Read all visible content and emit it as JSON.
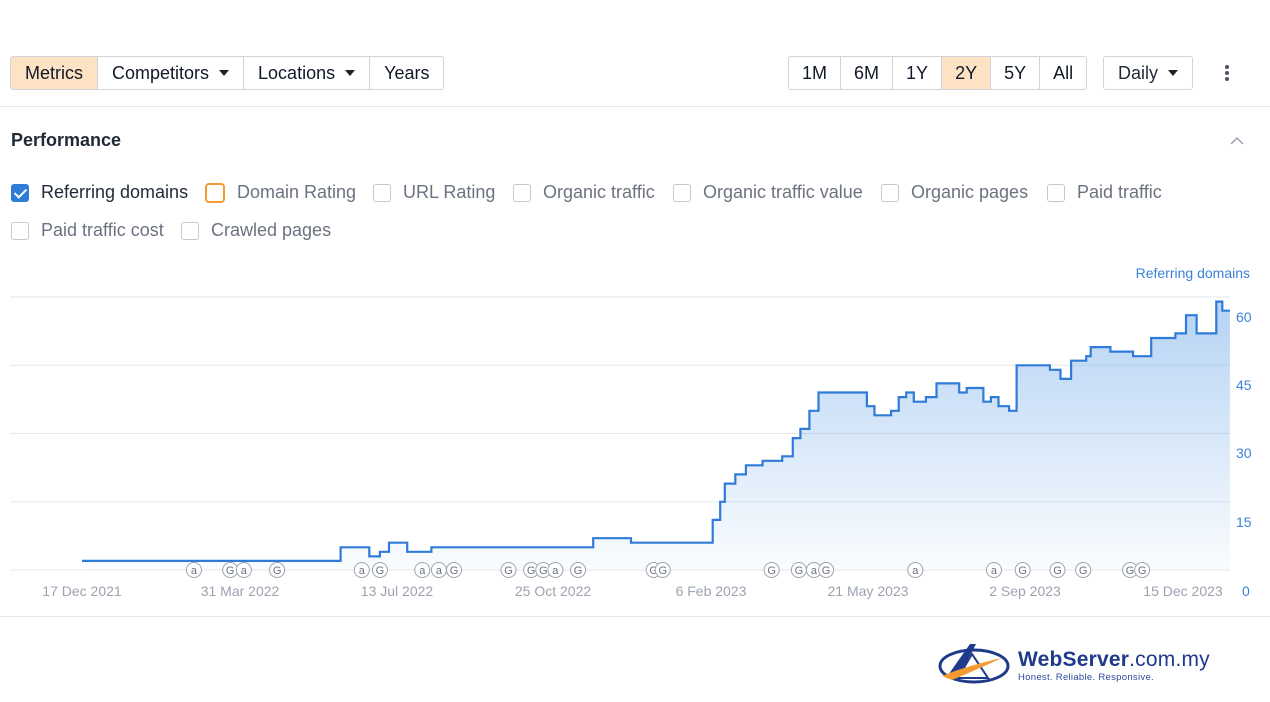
{
  "toolbar": {
    "tabs": [
      {
        "label": "Metrics",
        "active": true
      },
      {
        "label": "Competitors",
        "dropdown": true
      },
      {
        "label": "Locations",
        "dropdown": true
      },
      {
        "label": "Years"
      }
    ],
    "ranges": [
      {
        "label": "1M"
      },
      {
        "label": "6M"
      },
      {
        "label": "1Y"
      },
      {
        "label": "2Y",
        "active": true
      },
      {
        "label": "5Y"
      },
      {
        "label": "All"
      }
    ],
    "interval": "Daily"
  },
  "section": {
    "title": "Performance"
  },
  "metrics": [
    {
      "label": "Referring domains",
      "checked": true
    },
    {
      "label": "Domain Rating",
      "checked": false,
      "highlight": "#f39a33"
    },
    {
      "label": "URL Rating",
      "checked": false
    },
    {
      "label": "Organic traffic",
      "checked": false
    },
    {
      "label": "Organic traffic value",
      "checked": false
    },
    {
      "label": "Organic pages",
      "checked": false
    },
    {
      "label": "Paid traffic",
      "checked": false
    },
    {
      "label": "Paid traffic cost",
      "checked": false
    },
    {
      "label": "Crawled pages",
      "checked": false
    }
  ],
  "colors": {
    "accent": "#2f7bd8",
    "active_tab": "#fde2c4",
    "axis_text": "#3b82d6"
  },
  "chart_data": {
    "type": "area",
    "ylabel": "Referring domains",
    "y_ticks": [
      0,
      15,
      30,
      45,
      60
    ],
    "ylim": [
      0,
      60
    ],
    "x_ticks": [
      "17 Dec 2021",
      "31 Mar 2022",
      "13 Jul 2022",
      "25 Oct 2022",
      "6 Feb 2023",
      "21 May 2023",
      "2 Sep 2023",
      "15 Dec 2023"
    ],
    "grid": true,
    "series": [
      {
        "values": [
          [
            "2021-12-17",
            2
          ],
          [
            "2022-02-15",
            2
          ],
          [
            "2022-03-10",
            2
          ],
          [
            "2022-05-10",
            2
          ],
          [
            "2022-06-05",
            2
          ],
          [
            "2022-06-06",
            5
          ],
          [
            "2022-06-20",
            5
          ],
          [
            "2022-06-25",
            3
          ],
          [
            "2022-07-02",
            4
          ],
          [
            "2022-07-08",
            6
          ],
          [
            "2022-07-20",
            4
          ],
          [
            "2022-07-30",
            4
          ],
          [
            "2022-08-05",
            5
          ],
          [
            "2022-11-15",
            5
          ],
          [
            "2022-11-20",
            7
          ],
          [
            "2022-12-10",
            7
          ],
          [
            "2022-12-15",
            6
          ],
          [
            "2023-02-05",
            6
          ],
          [
            "2023-02-07",
            11
          ],
          [
            "2023-02-12",
            15
          ],
          [
            "2023-02-15",
            19
          ],
          [
            "2023-02-22",
            21
          ],
          [
            "2023-03-01",
            23
          ],
          [
            "2023-03-12",
            24
          ],
          [
            "2023-03-25",
            25
          ],
          [
            "2023-04-01",
            29
          ],
          [
            "2023-04-06",
            31
          ],
          [
            "2023-04-12",
            35
          ],
          [
            "2023-04-18",
            39
          ],
          [
            "2023-05-10",
            39
          ],
          [
            "2023-05-20",
            36
          ],
          [
            "2023-05-25",
            34
          ],
          [
            "2023-06-05",
            35
          ],
          [
            "2023-06-10",
            38
          ],
          [
            "2023-06-15",
            39
          ],
          [
            "2023-06-20",
            37
          ],
          [
            "2023-06-28",
            38
          ],
          [
            "2023-07-05",
            41
          ],
          [
            "2023-07-15",
            41
          ],
          [
            "2023-07-20",
            39
          ],
          [
            "2023-07-25",
            40
          ],
          [
            "2023-08-05",
            37
          ],
          [
            "2023-08-10",
            38
          ],
          [
            "2023-08-15",
            36
          ],
          [
            "2023-08-22",
            35
          ],
          [
            "2023-08-27",
            45
          ],
          [
            "2023-09-10",
            45
          ],
          [
            "2023-09-18",
            44
          ],
          [
            "2023-09-25",
            42
          ],
          [
            "2023-10-02",
            46
          ],
          [
            "2023-10-12",
            47
          ],
          [
            "2023-10-15",
            49
          ],
          [
            "2023-10-22",
            49
          ],
          [
            "2023-10-28",
            48
          ],
          [
            "2023-11-10",
            48
          ],
          [
            "2023-11-12",
            47
          ],
          [
            "2023-11-22",
            47
          ],
          [
            "2023-11-24",
            51
          ],
          [
            "2023-12-08",
            51
          ],
          [
            "2023-12-10",
            52
          ],
          [
            "2023-12-15",
            52
          ],
          [
            "2023-12-17",
            56
          ],
          [
            "2023-12-22",
            56
          ],
          [
            "2023-12-24",
            52
          ],
          [
            "2024-01-04",
            52
          ],
          [
            "2024-01-06",
            59
          ],
          [
            "2024-01-10",
            57
          ],
          [
            "2024-01-15",
            57
          ]
        ]
      }
    ],
    "annotations": [
      {
        "date": "2022-03-01",
        "kind": "a"
      },
      {
        "date": "2022-03-25",
        "kind": "G"
      },
      {
        "date": "2022-04-03",
        "kind": "a"
      },
      {
        "date": "2022-04-25",
        "kind": "G"
      },
      {
        "date": "2022-06-20",
        "kind": "a"
      },
      {
        "date": "2022-07-02",
        "kind": "G"
      },
      {
        "date": "2022-07-30",
        "kind": "a"
      },
      {
        "date": "2022-08-10",
        "kind": "a"
      },
      {
        "date": "2022-08-20",
        "kind": "G"
      },
      {
        "date": "2022-09-25",
        "kind": "G"
      },
      {
        "date": "2022-10-10",
        "kind": "G"
      },
      {
        "date": "2022-10-18",
        "kind": "G"
      },
      {
        "date": "2022-10-26",
        "kind": "a"
      },
      {
        "date": "2022-11-10",
        "kind": "G"
      },
      {
        "date": "2022-12-30",
        "kind": "G"
      },
      {
        "date": "2023-01-05",
        "kind": "G"
      },
      {
        "date": "2023-03-18",
        "kind": "G"
      },
      {
        "date": "2023-04-05",
        "kind": "G"
      },
      {
        "date": "2023-04-15",
        "kind": "a"
      },
      {
        "date": "2023-04-23",
        "kind": "G"
      },
      {
        "date": "2023-06-21",
        "kind": "a"
      },
      {
        "date": "2023-08-12",
        "kind": "a"
      },
      {
        "date": "2023-08-31",
        "kind": "G"
      },
      {
        "date": "2023-09-23",
        "kind": "G"
      },
      {
        "date": "2023-10-10",
        "kind": "G"
      },
      {
        "date": "2023-11-10",
        "kind": "G"
      },
      {
        "date": "2023-11-18",
        "kind": "G"
      }
    ]
  },
  "brand": {
    "name": "WebServer",
    "domain": ".com.my",
    "tagline": "Honest. Reliable. Responsive."
  }
}
